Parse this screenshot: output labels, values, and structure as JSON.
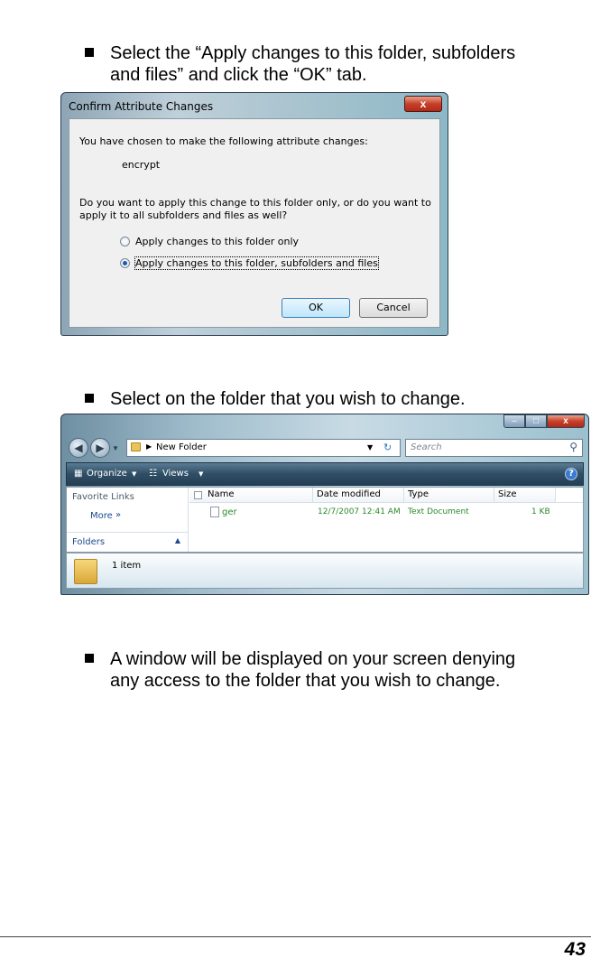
{
  "steps": [
    {
      "line1": "Select the “Apply changes to this folder, subfolders",
      "line2": "and files” and click the “OK” tab."
    },
    {
      "line1": "Select on the folder that you wish to change."
    },
    {
      "line1": "A window will be displayed on your screen denying",
      "line2": "any access to the folder that you wish to change."
    }
  ],
  "dialog": {
    "title": "Confirm Attribute Changes",
    "close_glyph": "x",
    "intro": "You have chosen to make the following attribute changes:",
    "change": "encrypt",
    "question_line1": "Do you want to apply this change to this folder only, or do you want to",
    "question_line2": "apply it to all subfolders and files as well?",
    "options": [
      {
        "label": "Apply changes to this folder only",
        "selected": false
      },
      {
        "label": "Apply changes to this folder, subfolders and files",
        "selected": true
      }
    ],
    "ok": "OK",
    "cancel": "Cancel"
  },
  "explorer": {
    "address": "New Folder",
    "search_placeholder": "Search",
    "organize": "Organize",
    "views": "Views",
    "help_glyph": "?",
    "favorite_links": "Favorite Links",
    "more": "More",
    "more_glyph": "»",
    "folders": "Folders",
    "columns": [
      "Name",
      "Date modified",
      "Type",
      "Size"
    ],
    "rows": [
      {
        "name": "ger",
        "date": "12/7/2007 12:41 AM",
        "type": "Text Document",
        "size": "1 KB"
      }
    ],
    "item_count": "1 item"
  },
  "page_number": "43",
  "colors": {
    "accent": "#1a5ab8",
    "file_text": "#2b8a2b"
  }
}
